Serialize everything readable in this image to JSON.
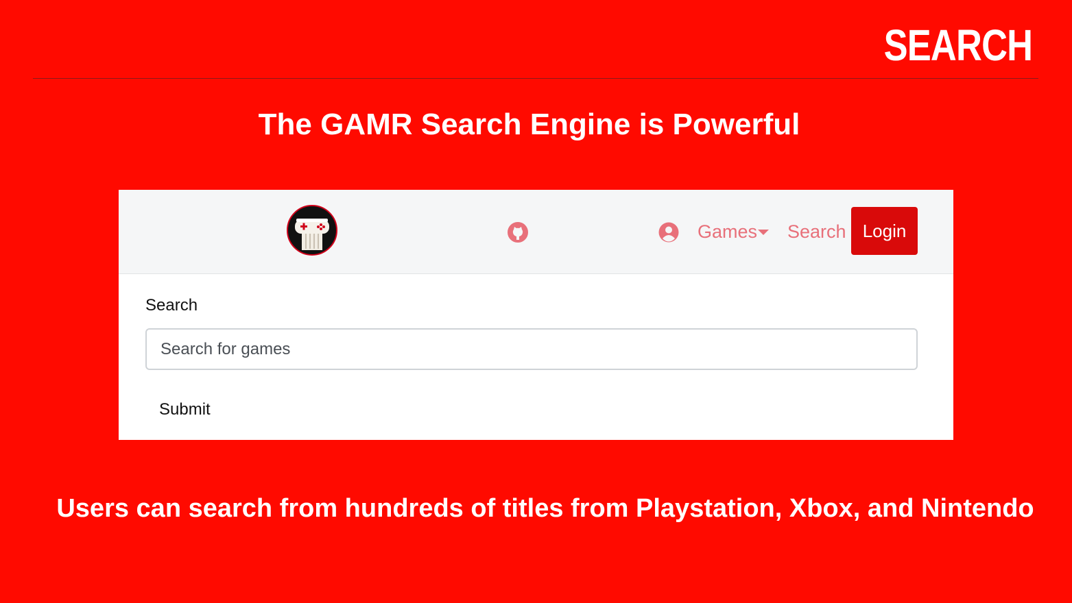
{
  "slide": {
    "heading": "SEARCH",
    "title": "The GAMR Search Engine is Powerful",
    "caption": "Users can search from hundreds of titles from Playstation, Xbox, and Nintendo",
    "background_color": "#ff0a00"
  },
  "navbar": {
    "logo_icon": "gamr-controller-logo",
    "github_icon": "github-icon",
    "user_icon": "user-circle-icon",
    "games_label": "Games",
    "search_label": "Search",
    "login_label": "Login",
    "accent_color": "#d90a0a",
    "link_color": "#e8707a"
  },
  "search_form": {
    "label": "Search",
    "placeholder": "Search for games",
    "value": "",
    "submit_label": "Submit"
  }
}
